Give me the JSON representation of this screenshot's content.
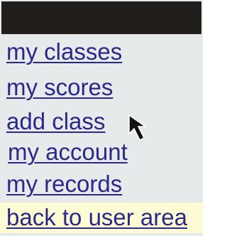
{
  "colors": {
    "header": "#221e1c",
    "panel": "#e6eaea",
    "link": "#2a2888",
    "highlight": "#fdfbd4"
  },
  "nav": {
    "items": [
      {
        "id": "my-classes",
        "label": "my classes"
      },
      {
        "id": "my-scores",
        "label": "my scores"
      },
      {
        "id": "add-class",
        "label": "add class"
      },
      {
        "id": "my-account",
        "label": "my account"
      },
      {
        "id": "my-records",
        "label": "my records"
      },
      {
        "id": "back-to-user-area",
        "label": "back to user area",
        "highlighted": true
      }
    ]
  },
  "cursor": {
    "icon": "mouse-pointer-arrow-icon"
  }
}
